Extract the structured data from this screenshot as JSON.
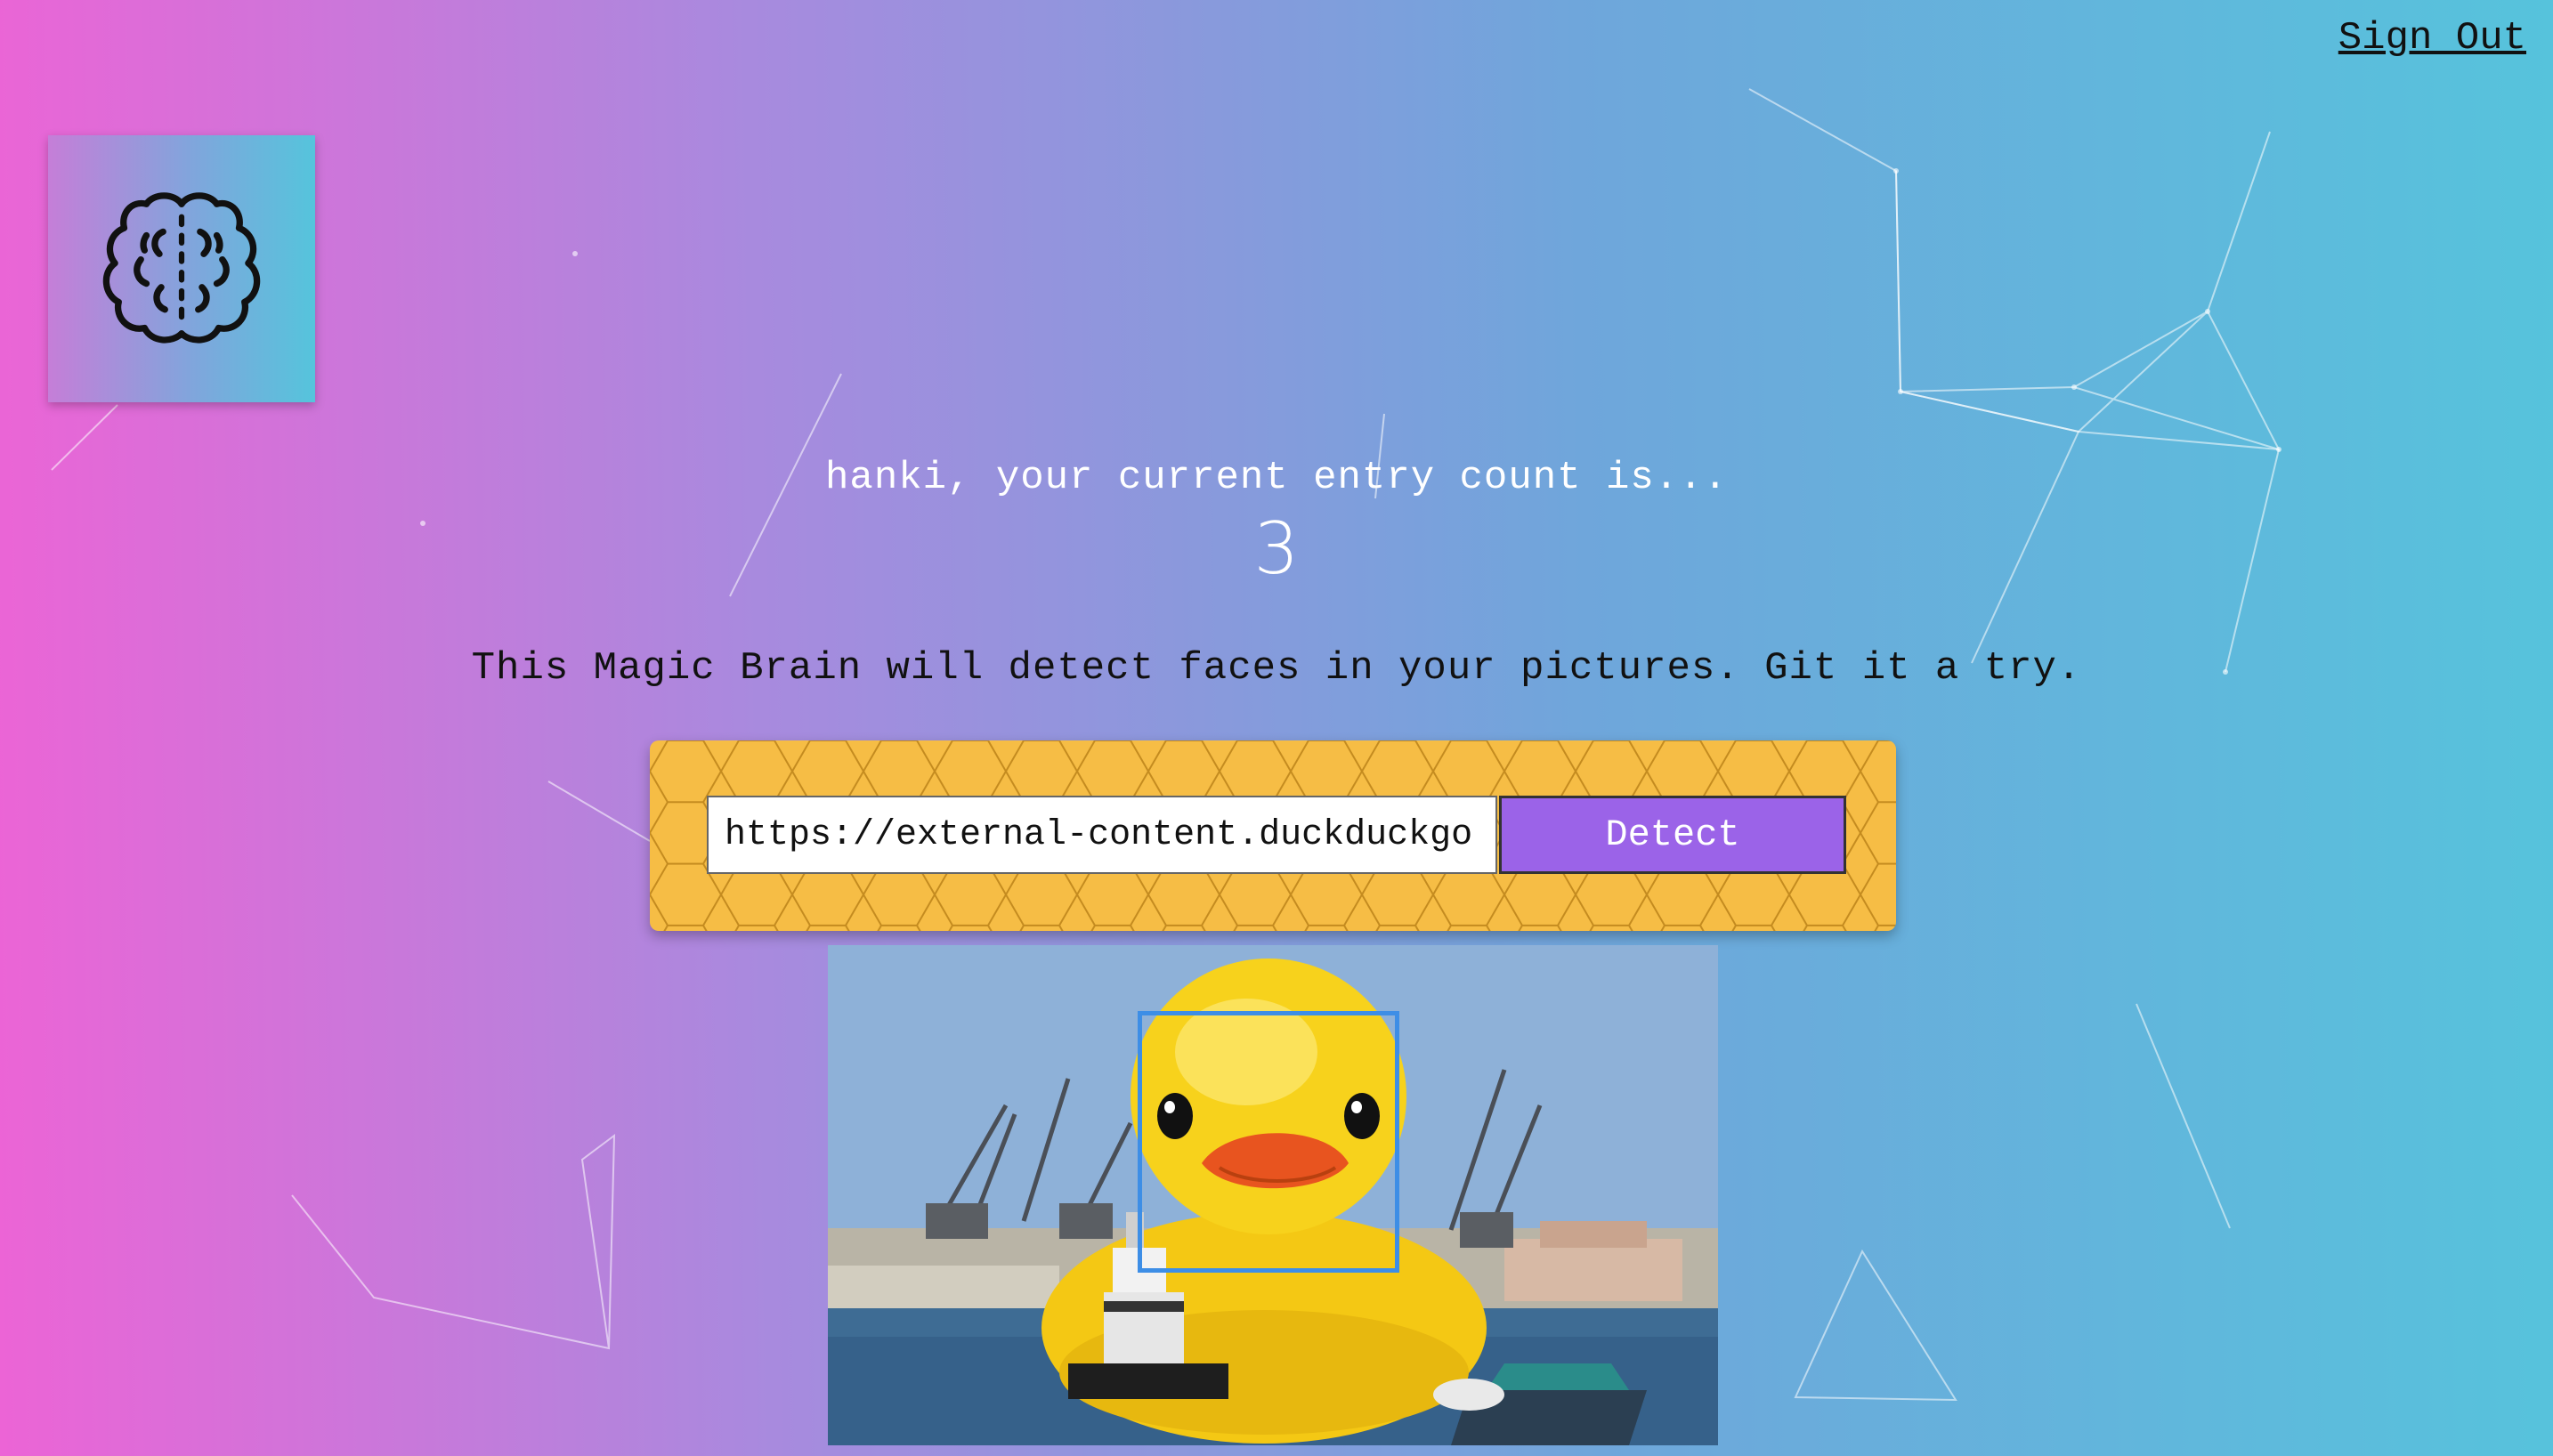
{
  "header": {
    "sign_out_label": "Sign Out"
  },
  "logo": {
    "icon": "brain-icon"
  },
  "greeting": {
    "text": "hanki, your current entry count is...",
    "count": "3"
  },
  "tagline": "This Magic Brain will detect faces in your pictures. Git it a try.",
  "form": {
    "url_value": "https://external-content.duckduckgo.",
    "detect_label": "Detect"
  },
  "colors": {
    "gradient_start": "#ec64d6",
    "gradient_end": "#56c3dc",
    "panel": "#f6bd45",
    "button": "#9b63e8",
    "face_box": "#3d8ee6"
  }
}
